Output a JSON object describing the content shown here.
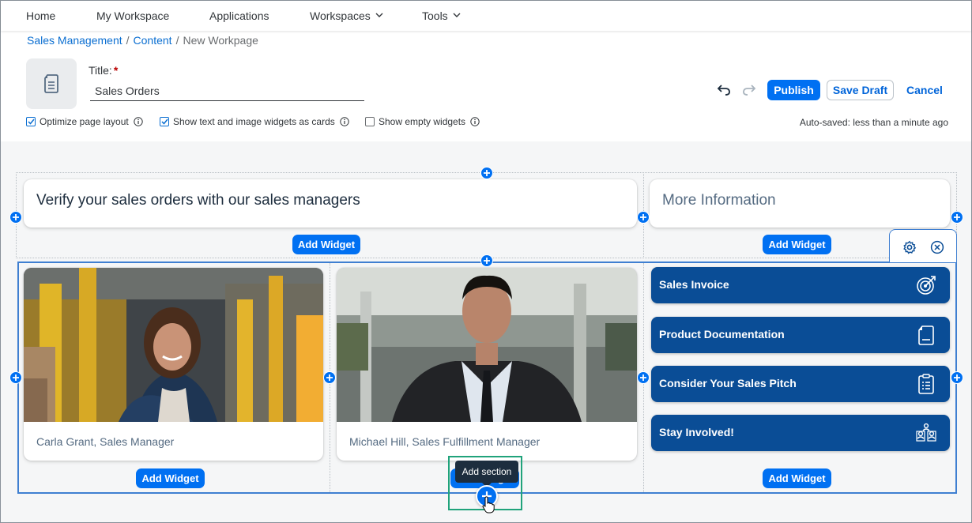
{
  "nav": {
    "home": "Home",
    "my_workspace": "My Workspace",
    "applications": "Applications",
    "workspaces": "Workspaces",
    "tools": "Tools"
  },
  "breadcrumb": {
    "item1": "Sales Management",
    "item2": "Content",
    "current": "New Workpage",
    "separator": "/"
  },
  "page": {
    "title_label": "Title:",
    "required_mark": "*",
    "title_value": "Sales Orders",
    "icon": "document-icon"
  },
  "actions": {
    "publish": "Publish",
    "save_draft": "Save Draft",
    "cancel": "Cancel"
  },
  "options": {
    "optimize_layout": {
      "label": "Optimize page layout",
      "checked": true
    },
    "show_cards": {
      "label": "Show text and image widgets as cards",
      "checked": true
    },
    "show_empty": {
      "label": "Show empty widgets",
      "checked": false
    }
  },
  "autosave": "Auto-saved: less than a minute ago",
  "section1": {
    "headline": "Verify your sales orders with our sales managers",
    "more_info": "More Information"
  },
  "section2": {
    "person1": "Carla Grant, Sales Manager",
    "person2": "Michael Hill, Sales Fulfillment Manager",
    "tiles": [
      {
        "label": "Sales Invoice",
        "icon": "target-icon"
      },
      {
        "label": "Product Documentation",
        "icon": "document-icon"
      },
      {
        "label": "Consider Your Sales Pitch",
        "icon": "clipboard-list-icon"
      },
      {
        "label": "Stay Involved!",
        "icon": "people-network-icon"
      }
    ]
  },
  "add_widget": "Add Widget",
  "tooltip": "Add section",
  "colors": {
    "accent": "#0070f2",
    "tile": "#0a4d96",
    "highlight": "#20a37b"
  }
}
